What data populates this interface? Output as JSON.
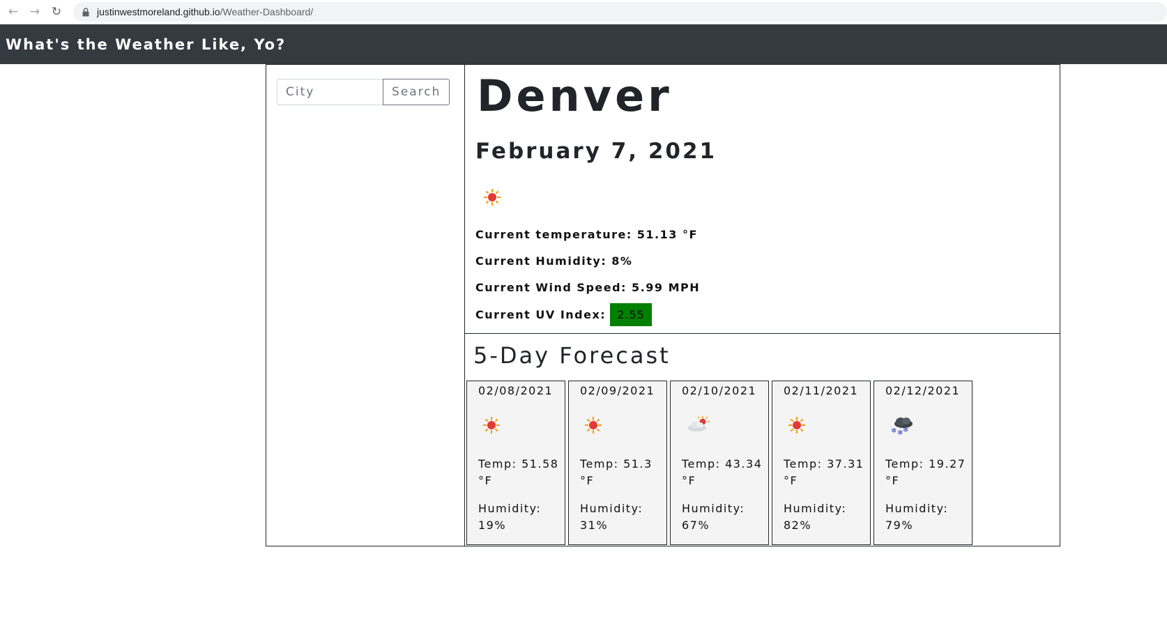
{
  "browser": {
    "url_host": "justinwestmoreland.github.io",
    "url_path": "/Weather-Dashboard/"
  },
  "header": {
    "title": "What's the Weather Like, Yo?"
  },
  "search": {
    "placeholder": "City",
    "button_label": "Search"
  },
  "current": {
    "city": "Denver",
    "date": "February 7, 2021",
    "icon": "sun-icon",
    "temperature": "Current temperature: 51.13 °F",
    "humidity": "Current Humidity: 8%",
    "wind": "Current Wind Speed: 5.99 MPH",
    "uv_label": "Current UV Index:",
    "uv_value": "2.55",
    "uv_color": "#008000"
  },
  "forecast": {
    "title": "5-Day Forecast",
    "days": [
      {
        "date": "02/08/2021",
        "icon": "sun-icon",
        "temp": "Temp: 51.58 °F",
        "humidity": "Humidity: 19%"
      },
      {
        "date": "02/09/2021",
        "icon": "sun-icon",
        "temp": "Temp: 51.3 °F",
        "humidity": "Humidity: 31%"
      },
      {
        "date": "02/10/2021",
        "icon": "partly-cloudy-icon",
        "temp": "Temp: 43.34 °F",
        "humidity": "Humidity: 67%"
      },
      {
        "date": "02/11/2021",
        "icon": "sun-icon",
        "temp": "Temp: 37.31 °F",
        "humidity": "Humidity: 82%"
      },
      {
        "date": "02/12/2021",
        "icon": "snow-icon",
        "temp": "Temp: 19.27 °F",
        "humidity": "Humidity: 79%"
      }
    ]
  }
}
